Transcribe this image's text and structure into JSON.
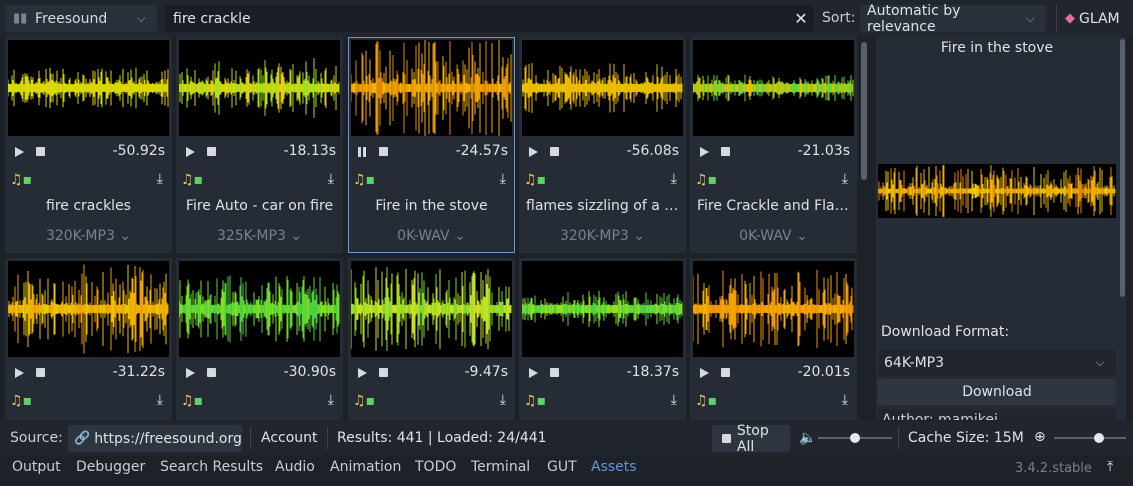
{
  "toolbar": {
    "source_select": "Freesound",
    "search_value": "fire crackle",
    "sort_label": "Sort:",
    "sort_value": "Automatic by relevance",
    "glam_label": "GLAM"
  },
  "cards": [
    {
      "duration": "-50.92s",
      "title": "fire crackles",
      "format": "320K-MP3",
      "playing": false,
      "selected": false,
      "colors": [
        "#e8d000",
        "#c8e000"
      ]
    },
    {
      "duration": "-18.13s",
      "title": "Fire Auto - car on fire",
      "format": "325K-MP3",
      "playing": false,
      "selected": false,
      "colors": [
        "#a6e01a",
        "#e0d010"
      ]
    },
    {
      "duration": "-24.57s",
      "title": "Fire in the stove",
      "format": "0K-WAV",
      "playing": true,
      "selected": true,
      "colors": [
        "#f0b000",
        "#e08a00"
      ]
    },
    {
      "duration": "-56.08s",
      "title": "flames sizzling of a b...",
      "format": "320K-MP3",
      "playing": false,
      "selected": false,
      "colors": [
        "#f0b800",
        "#e0c000"
      ]
    },
    {
      "duration": "-21.03s",
      "title": "Fire Crackle and Flam...",
      "format": "0K-WAV",
      "playing": false,
      "selected": false,
      "colors": [
        "#60d840",
        "#e0c000"
      ]
    },
    {
      "duration": "-31.22s",
      "title": "",
      "format": "",
      "playing": false,
      "selected": false,
      "colors": [
        "#e8c800",
        "#f0a000"
      ]
    },
    {
      "duration": "-30.90s",
      "title": "",
      "format": "",
      "playing": false,
      "selected": false,
      "colors": [
        "#50d040",
        "#80e020"
      ]
    },
    {
      "duration": "-9.47s",
      "title": "",
      "format": "",
      "playing": false,
      "selected": false,
      "colors": [
        "#c8e020",
        "#80d830"
      ]
    },
    {
      "duration": "-18.37s",
      "title": "",
      "format": "",
      "playing": false,
      "selected": false,
      "colors": [
        "#50d040",
        "#90e020"
      ]
    },
    {
      "duration": "-20.01s",
      "title": "",
      "format": "",
      "playing": false,
      "selected": false,
      "colors": [
        "#f09000",
        "#f0b000"
      ]
    }
  ],
  "side": {
    "title": "Fire in the stove",
    "download_format_label": "Download Format:",
    "download_format_value": "64K-MP3",
    "download_button": "Download",
    "author_text": "Author: mamikei"
  },
  "status": {
    "source_label": "Source:",
    "source_link": "https://freesound.org",
    "account": "Account",
    "results": "Results: 441 | Loaded: 24/441",
    "stop_all": "Stop All",
    "volume": 0.5,
    "cache_size": "Cache Size: 15M",
    "zoom": 0.62
  },
  "bottom_tabs": [
    "Output",
    "Debugger",
    "Search Results",
    "Audio",
    "Animation",
    "TODO",
    "Terminal",
    "GUT",
    "Assets"
  ],
  "active_tab": "Assets",
  "version": "3.4.2.stable",
  "icons": {
    "source": "freesound-icon",
    "clear": "clear-icon",
    "glam": "gem-icon",
    "link": "link-icon",
    "volume": "speaker-icon",
    "zoom": "zoom-icon",
    "pin": "pin-icon"
  }
}
